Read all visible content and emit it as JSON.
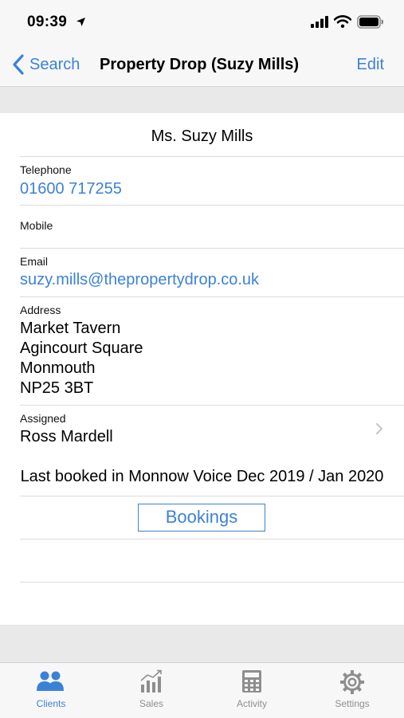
{
  "status": {
    "time": "09:39"
  },
  "nav": {
    "back_label": "Search",
    "title": "Property Drop (Suzy Mills)",
    "edit_label": "Edit"
  },
  "client": {
    "name": "Ms. Suzy Mills",
    "telephone": {
      "label": "Telephone",
      "value": "01600 717255"
    },
    "mobile": {
      "label": "Mobile",
      "value": ""
    },
    "email": {
      "label": "Email",
      "value": "suzy.mills@thepropertydrop.co.uk"
    },
    "address": {
      "label": "Address",
      "lines": [
        "Market Tavern",
        "Agincourt Square",
        "Monmouth",
        "NP25 3BT"
      ]
    },
    "assigned": {
      "label": "Assigned",
      "value": "Ross Mardell"
    },
    "last_booked": "Last booked in Monnow Voice Dec 2019 / Jan 2020",
    "bookings_label": "Bookings"
  },
  "tabs": [
    {
      "label": "Clients",
      "icon": "clients-icon",
      "active": true
    },
    {
      "label": "Sales",
      "icon": "sales-chart-icon",
      "active": false
    },
    {
      "label": "Activity",
      "icon": "calculator-icon",
      "active": false
    },
    {
      "label": "Settings",
      "icon": "gear-icon",
      "active": false
    }
  ],
  "colors": {
    "accent": "#3b82d6",
    "background": "#ffffff",
    "band": "#e9e9e9",
    "inactive_tab": "#8e8e8e"
  }
}
